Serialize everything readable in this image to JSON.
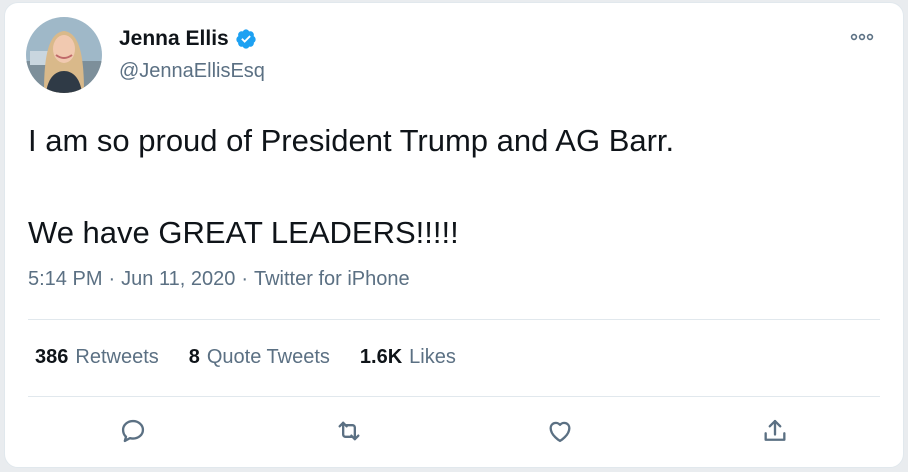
{
  "author": {
    "display_name": "Jenna Ellis",
    "handle": "@JennaEllisEsq",
    "verified": true
  },
  "tweet": {
    "text": "I am so proud of President Trump and AG Barr.\n\nWe have GREAT LEADERS!!!!!",
    "time": "5:14 PM",
    "date": "Jun 11, 2020",
    "source": "Twitter for iPhone",
    "separator": "·"
  },
  "stats": {
    "retweets": {
      "count": "386",
      "label": "Retweets"
    },
    "quotes": {
      "count": "8",
      "label": "Quote Tweets"
    },
    "likes": {
      "count": "1.6K",
      "label": "Likes"
    }
  },
  "icons": {
    "more": "more-icon",
    "reply": "reply-icon",
    "retweet": "retweet-icon",
    "like": "like-icon",
    "share": "share-icon",
    "verified": "verified-badge-icon"
  },
  "colors": {
    "accent": "#1da1f2",
    "text": "#0f1419",
    "secondary": "#5b7083",
    "border": "#e1e8ed"
  }
}
